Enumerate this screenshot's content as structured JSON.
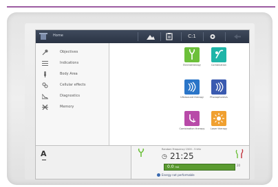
{
  "header": {
    "home_label": "Home",
    "channel_label": "C:1"
  },
  "sidebar": {
    "items": [
      {
        "label": "Objectives",
        "icon": "tools-icon"
      },
      {
        "label": "Indications",
        "icon": "list-icon"
      },
      {
        "label": "Body Area",
        "icon": "body-icon"
      },
      {
        "label": "Cellular effects",
        "icon": "cells-icon"
      },
      {
        "label": "Diagnostics",
        "icon": "graph-icon"
      },
      {
        "label": "Memory",
        "icon": "memory-icon"
      }
    ]
  },
  "therapies": [
    {
      "label": "Electrotherapy",
      "color": "#6cc03a",
      "icon": "electrotherapy-icon"
    },
    {
      "label": "Combination",
      "color": "#1fb5a8",
      "icon": "combination-icon"
    },
    {
      "label": "Ultrasound therapy",
      "color": "#2a75c8",
      "icon": "ultrasound-icon"
    },
    {
      "label": "Phonophoresis",
      "color": "#3a5ab0",
      "icon": "phonophoresis-icon"
    },
    {
      "label": "Combination therapy",
      "color": "#b84aa8",
      "icon": "combination-therapy-icon"
    },
    {
      "label": "Laser therapy",
      "color": "#f0a030",
      "icon": "laser-icon"
    }
  ],
  "footer": {
    "big_letter": "A",
    "status_text": "Random Frequency 1500 - 5 kHz",
    "timer": "21:25",
    "meter_value": "0.0",
    "meter_unit": "mA",
    "meter_max": "20",
    "message": "Energy not performable",
    "accent_color": "#5a9a30"
  }
}
